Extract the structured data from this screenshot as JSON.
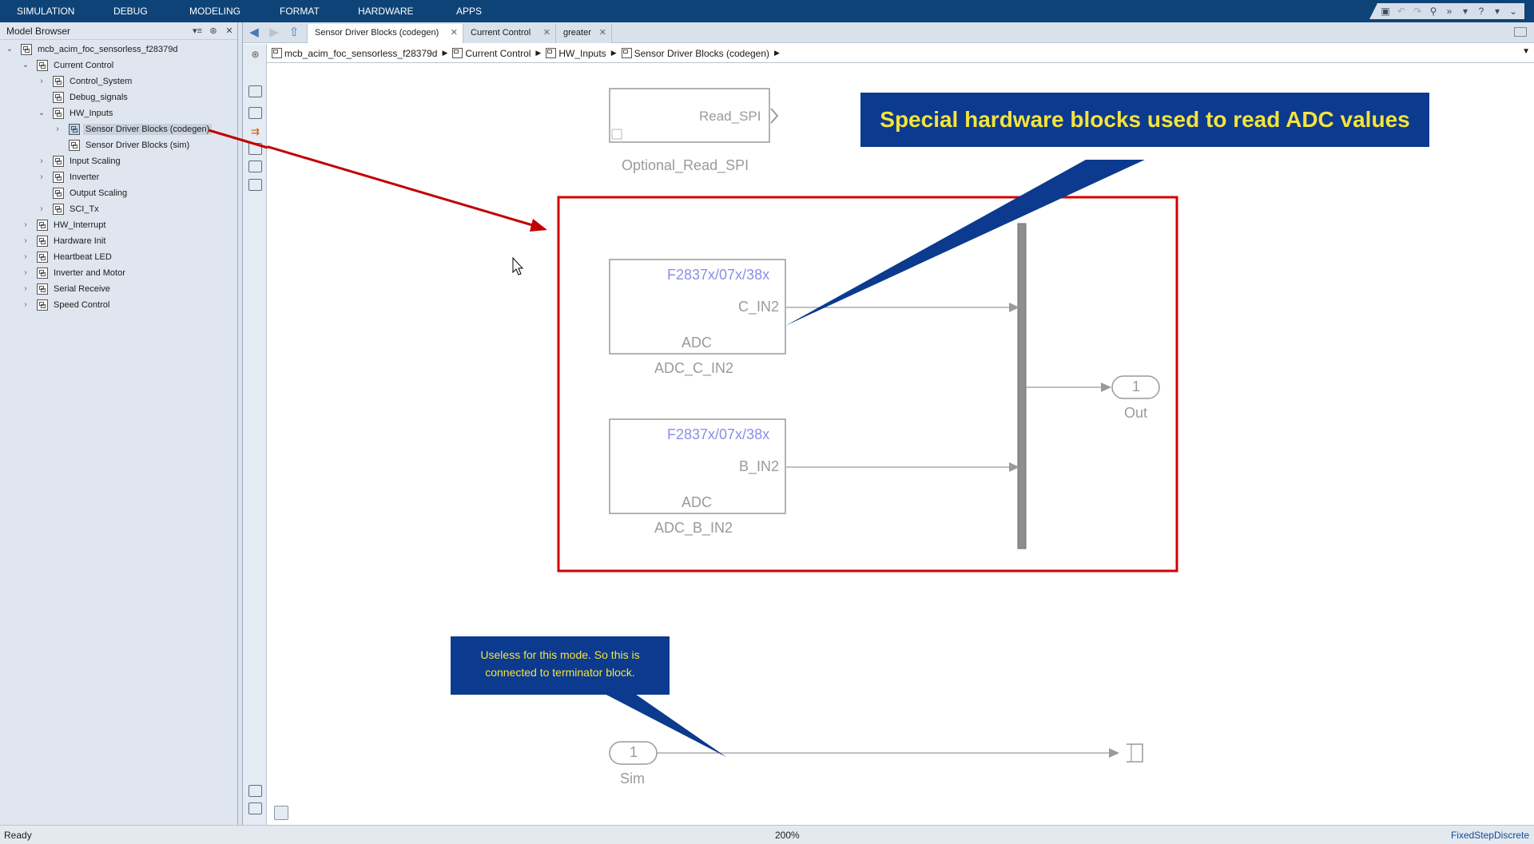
{
  "ribbon": {
    "tabs": [
      "SIMULATION",
      "DEBUG",
      "MODELING",
      "FORMAT",
      "HARDWARE",
      "APPS"
    ]
  },
  "browser": {
    "title": "Model Browser",
    "tree": [
      {
        "label": "mcb_acim_foc_sensorless_f28379d",
        "expanded": true
      },
      {
        "label": "Current Control",
        "expanded": true
      },
      {
        "label": "Control_System",
        "expanded": false
      },
      {
        "label": "Debug_signals"
      },
      {
        "label": "HW_Inputs",
        "expanded": true
      },
      {
        "label": "Sensor Driver Blocks (codegen)",
        "expanded": false,
        "selected": true
      },
      {
        "label": "Sensor Driver Blocks (sim)"
      },
      {
        "label": "Input Scaling",
        "expanded": false
      },
      {
        "label": "Inverter",
        "expanded": false
      },
      {
        "label": "Output Scaling"
      },
      {
        "label": "SCI_Tx",
        "expanded": false
      },
      {
        "label": "HW_Interrupt",
        "expanded": false
      },
      {
        "label": "Hardware Init",
        "expanded": false
      },
      {
        "label": "Heartbeat LED",
        "expanded": false
      },
      {
        "label": "Inverter and Motor",
        "expanded": false
      },
      {
        "label": "Serial Receive",
        "expanded": false
      },
      {
        "label": "Speed Control",
        "expanded": false
      }
    ]
  },
  "tabs": [
    {
      "label": "Sensor Driver Blocks (codegen)",
      "active": true
    },
    {
      "label": "Current Control"
    },
    {
      "label": "greater"
    }
  ],
  "breadcrumb": [
    "mcb_acim_foc_sensorless_f28379d",
    "Current Control",
    "HW_Inputs",
    "Sensor Driver Blocks (codegen)"
  ],
  "diagram": {
    "read_spi": {
      "port_label": "Read_SPI",
      "name": "Optional_Read_SPI"
    },
    "adc1": {
      "family": "F2837x/07x/38x",
      "port": "C_IN2",
      "type": "ADC",
      "name": "ADC_C_IN2"
    },
    "adc2": {
      "family": "F2837x/07x/38x",
      "port": "B_IN2",
      "type": "ADC",
      "name": "ADC_B_IN2"
    },
    "out_port": {
      "number": "1",
      "name": "Out"
    },
    "in_port": {
      "number": "1",
      "name": "Sim"
    },
    "callout_main": "Special hardware blocks used to read ADC values",
    "callout_small": "Useless for this mode. So this is connected to terminator block.",
    "highlight_color": "#d40000",
    "callout_color": "#0b3a8e",
    "callout_text_color": "#f5e33b"
  },
  "status": {
    "left": "Ready",
    "zoom": "200%",
    "solver": "FixedStepDiscrete"
  }
}
